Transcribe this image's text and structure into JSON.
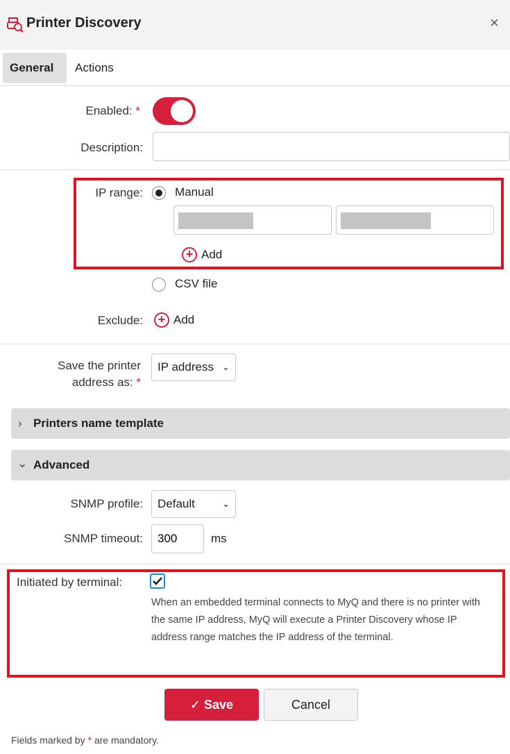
{
  "window": {
    "title": "Printer Discovery",
    "close_glyph": "×",
    "title_icon": "printer-search-icon"
  },
  "tabs": [
    {
      "label": "General",
      "active": true
    },
    {
      "label": "Actions",
      "active": false
    }
  ],
  "general": {
    "enabled_label": "Enabled:",
    "enabled": true,
    "description_label": "Description:",
    "description_value": ""
  },
  "ip_range": {
    "label": "IP range:",
    "manual_label": "Manual",
    "manual_selected": true,
    "from_value": "",
    "to_value": "",
    "add_label": "Add",
    "csv_label": "CSV file",
    "csv_selected": false
  },
  "exclude": {
    "label": "Exclude:",
    "add_label": "Add"
  },
  "save_address": {
    "label_line1": "Save the printer",
    "label_line2": "address as:",
    "selected": "IP address"
  },
  "sections": {
    "name_template": "Printers name template",
    "advanced": "Advanced"
  },
  "advanced": {
    "snmp_profile_label": "SNMP profile:",
    "snmp_profile_value": "Default",
    "snmp_timeout_label": "SNMP timeout:",
    "snmp_timeout_value": "300",
    "snmp_timeout_unit": "ms"
  },
  "terminal": {
    "label": "Initiated by terminal:",
    "checked": true,
    "description": "When an embedded terminal connects to MyQ and there is no printer with the same IP address, MyQ will execute a Printer Discovery whose IP address range matches the IP address of the terminal."
  },
  "buttons": {
    "save": "Save",
    "cancel": "Cancel"
  },
  "footer": {
    "prefix": "Fields marked by",
    "suffix": "are mandatory."
  },
  "required_marker": "*",
  "colors": {
    "accent": "#d6203b",
    "highlight_box": "#e0141e",
    "checkbox_border": "#1a8cd8"
  }
}
